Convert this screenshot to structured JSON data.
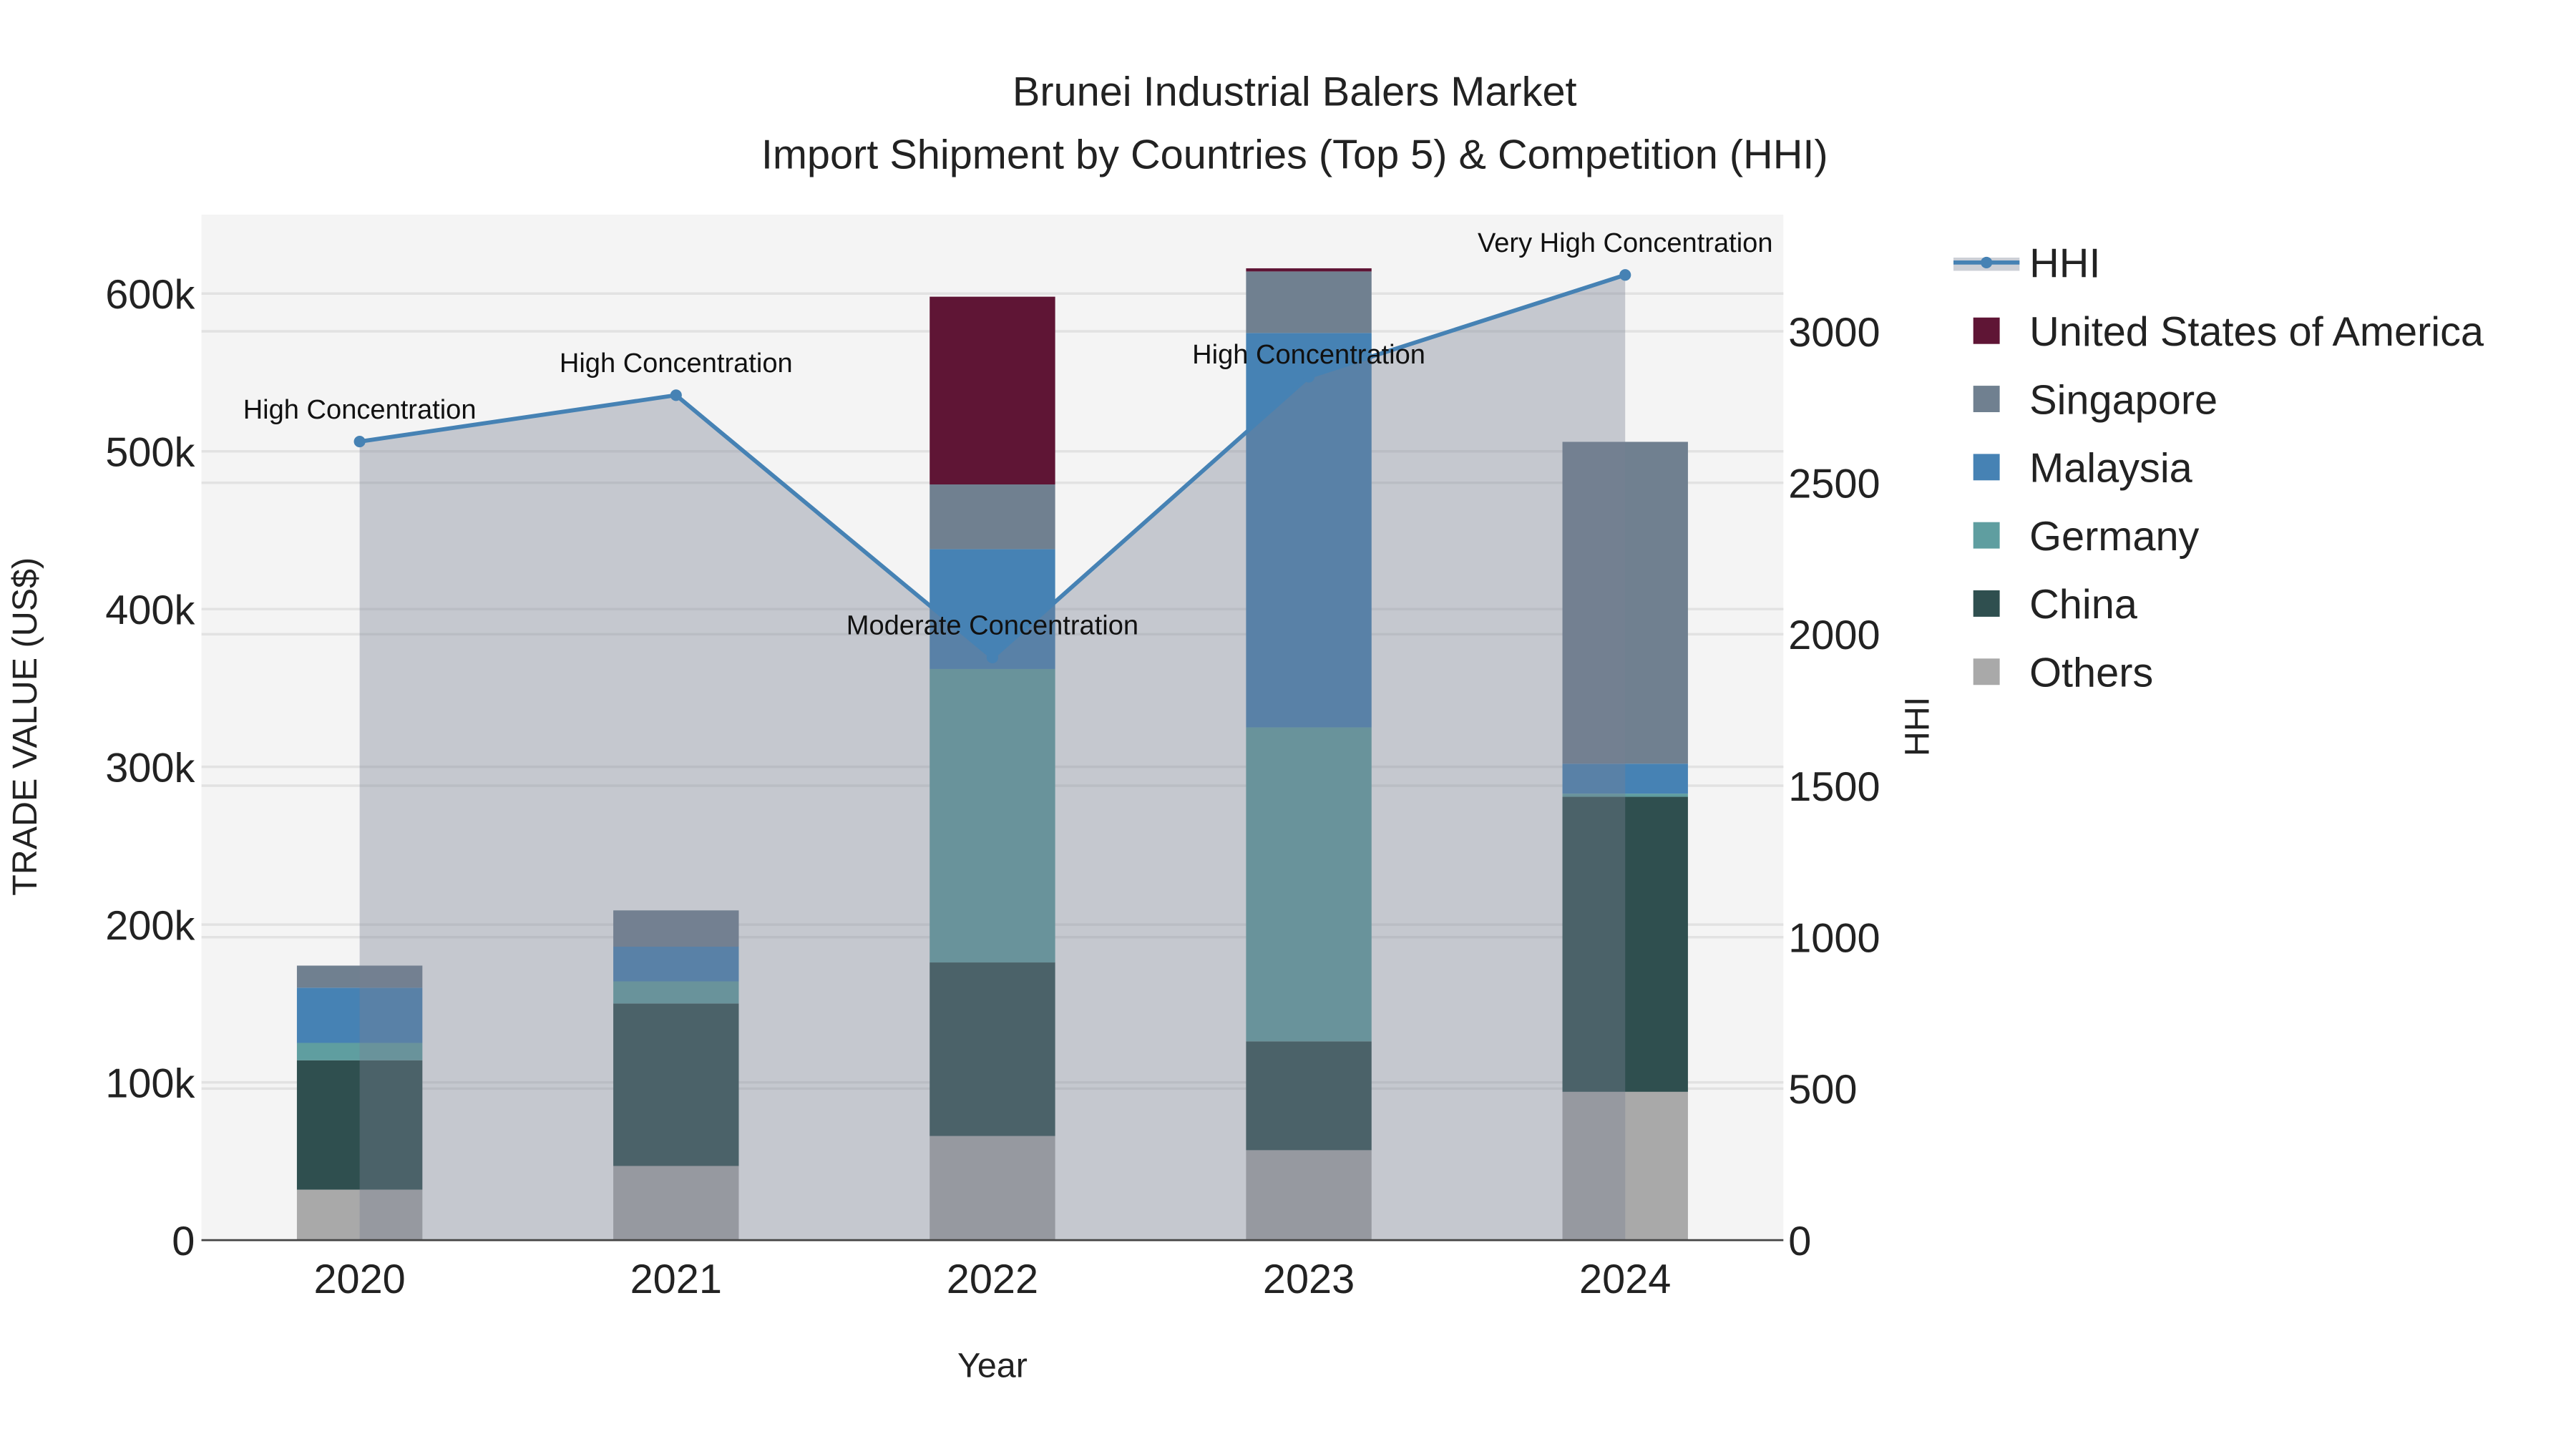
{
  "chart_data": {
    "type": "bar",
    "title": "Brunei Industrial Balers Market",
    "subtitle": "Import Shipment by Countries (Top 5) & Competition (HHI)",
    "xlabel": "Year",
    "ylabel": "TRADE VALUE (US$)",
    "y2label": "HHI",
    "categories": [
      "2020",
      "2021",
      "2022",
      "2023",
      "2024"
    ],
    "ylim": [
      0,
      650000
    ],
    "y2lim": [
      0,
      3385
    ],
    "yticks": [
      0,
      100000,
      200000,
      300000,
      400000,
      500000,
      600000
    ],
    "ytick_labels": [
      "0",
      "100k",
      "200k",
      "300k",
      "400k",
      "500k",
      "600k"
    ],
    "y2ticks": [
      0,
      500,
      1000,
      1500,
      2000,
      2500,
      3000
    ],
    "y2tick_labels": [
      "0",
      "500",
      "1000",
      "1500",
      "2000",
      "2500",
      "3000"
    ],
    "stacked": true,
    "series": [
      {
        "name": "Others",
        "color": "#a9a9a9",
        "values": [
          32000,
          47000,
          66000,
          57000,
          94000
        ]
      },
      {
        "name": "China",
        "color": "#2f4f4f",
        "values": [
          82000,
          103000,
          110000,
          69000,
          187000
        ]
      },
      {
        "name": "Germany",
        "color": "#5f9ea0",
        "values": [
          11000,
          14000,
          186000,
          199000,
          2000
        ]
      },
      {
        "name": "Malaysia",
        "color": "#4682b4",
        "values": [
          35000,
          22000,
          76000,
          250000,
          19000
        ]
      },
      {
        "name": "Singapore",
        "color": "#708090",
        "values": [
          14000,
          23000,
          41000,
          39000,
          204000
        ]
      },
      {
        "name": "United States of America",
        "color": "#5f1535",
        "values": [
          0,
          0,
          119000,
          2000,
          0
        ]
      }
    ],
    "hhi": {
      "name": "HHI",
      "color": "#4682b4",
      "values": [
        2636,
        2789,
        1923,
        2850,
        3186
      ],
      "annotations": [
        "High Concentration",
        "High Concentration",
        "Moderate Concentration",
        "High Concentration",
        "Very High Concentration"
      ]
    },
    "legend_order": [
      "HHI",
      "United States of America",
      "Singapore",
      "Malaysia",
      "Germany",
      "China",
      "Others"
    ],
    "legend_position": "right",
    "grid": true
  }
}
